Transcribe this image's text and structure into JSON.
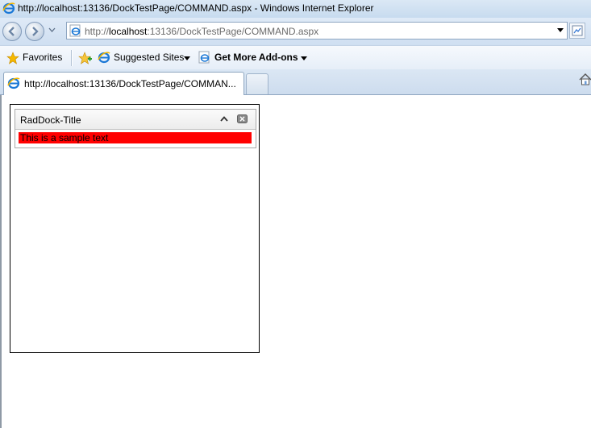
{
  "window": {
    "title": "http://localhost:13136/DockTestPage/COMMAND.aspx - Windows Internet Explorer"
  },
  "address_bar": {
    "url_prefix": "http://",
    "url_host": "localhost",
    "url_rest": ":13136/DockTestPage/COMMAND.aspx"
  },
  "favorites_bar": {
    "favorites_label": "Favorites",
    "suggested_sites_label": "Suggested Sites",
    "get_addons_label": "Get More Add-ons"
  },
  "tabs": [
    {
      "label": "http://localhost:13136/DockTestPage/COMMAN...",
      "active": true
    }
  ],
  "dock": {
    "title": "RadDock-Title",
    "content_text": "This is a sample text",
    "content_bg_color": "#ff0000"
  },
  "icons": {
    "browser": "ie-logo-icon",
    "back": "back-arrow-icon",
    "forward": "forward-arrow-icon",
    "compat": "compatibility-view-icon",
    "favorites": "star-icon",
    "add_favorites": "add-favorites-icon",
    "home": "home-icon",
    "collapse": "chevron-up-icon",
    "close": "close-icon"
  }
}
